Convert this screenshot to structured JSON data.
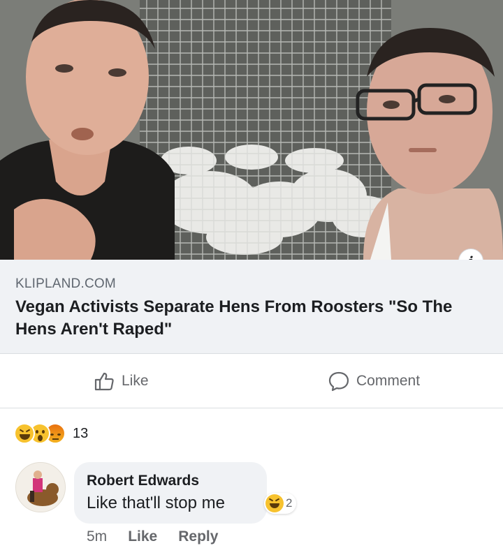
{
  "post": {
    "image": {
      "description_icon": "info-icon",
      "info_label": "i"
    },
    "link": {
      "domain": "KLIPLAND.COM",
      "title": "Vegan Activists Separate Hens From Roosters \"So The Hens Aren't Raped\""
    },
    "actions": {
      "like_label": "Like",
      "like_icon": "thumbs-up-icon",
      "comment_label": "Comment",
      "comment_icon": "speech-bubble-icon"
    },
    "reactions": {
      "icons": [
        "haha-emoji",
        "wow-emoji",
        "angry-emoji"
      ],
      "count": "13"
    }
  },
  "comment": {
    "author": "Robert Edwards",
    "text": "Like that'll stop me",
    "reaction_icon": "haha-emoji",
    "reaction_count": "2",
    "time": "5m",
    "like_label": "Like",
    "reply_label": "Reply"
  },
  "colors": {
    "link_background": "#f0f2f5",
    "secondary_text": "#65676b",
    "primary_text": "#1c1e21",
    "reaction_yellow": "#f7c22e",
    "reaction_orange": "#e9710f"
  }
}
